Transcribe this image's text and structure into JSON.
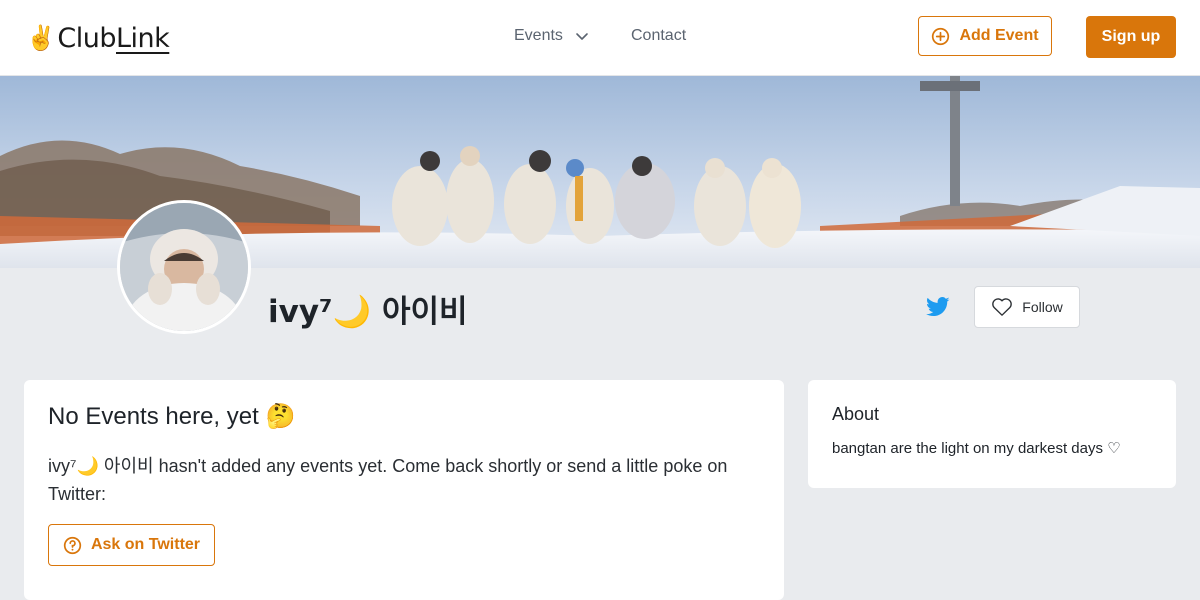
{
  "header": {
    "logo_hand": "✌️",
    "logo_club": "Club",
    "logo_link": "Link",
    "nav_events": "Events",
    "nav_contact": "Contact",
    "add_event": "Add Event",
    "sign_up": "Sign up"
  },
  "profile": {
    "name": "ivy⁷🌙 아이비",
    "follow": "Follow",
    "banner_icon": "banner-photo",
    "avatar_icon": "avatar-photo"
  },
  "events_card": {
    "title": "No Events here, yet 🤔",
    "description": "ivy⁷🌙 아이비 hasn't added any events yet. Come back shortly or send a little poke on Twitter:",
    "ask_button": "Ask on Twitter"
  },
  "about_card": {
    "title": "About",
    "text": "bangtan are the light on my darkest days ♡"
  },
  "colors": {
    "accent": "#d9760b",
    "twitter": "#1d9bf0",
    "background": "#e9ebee"
  }
}
